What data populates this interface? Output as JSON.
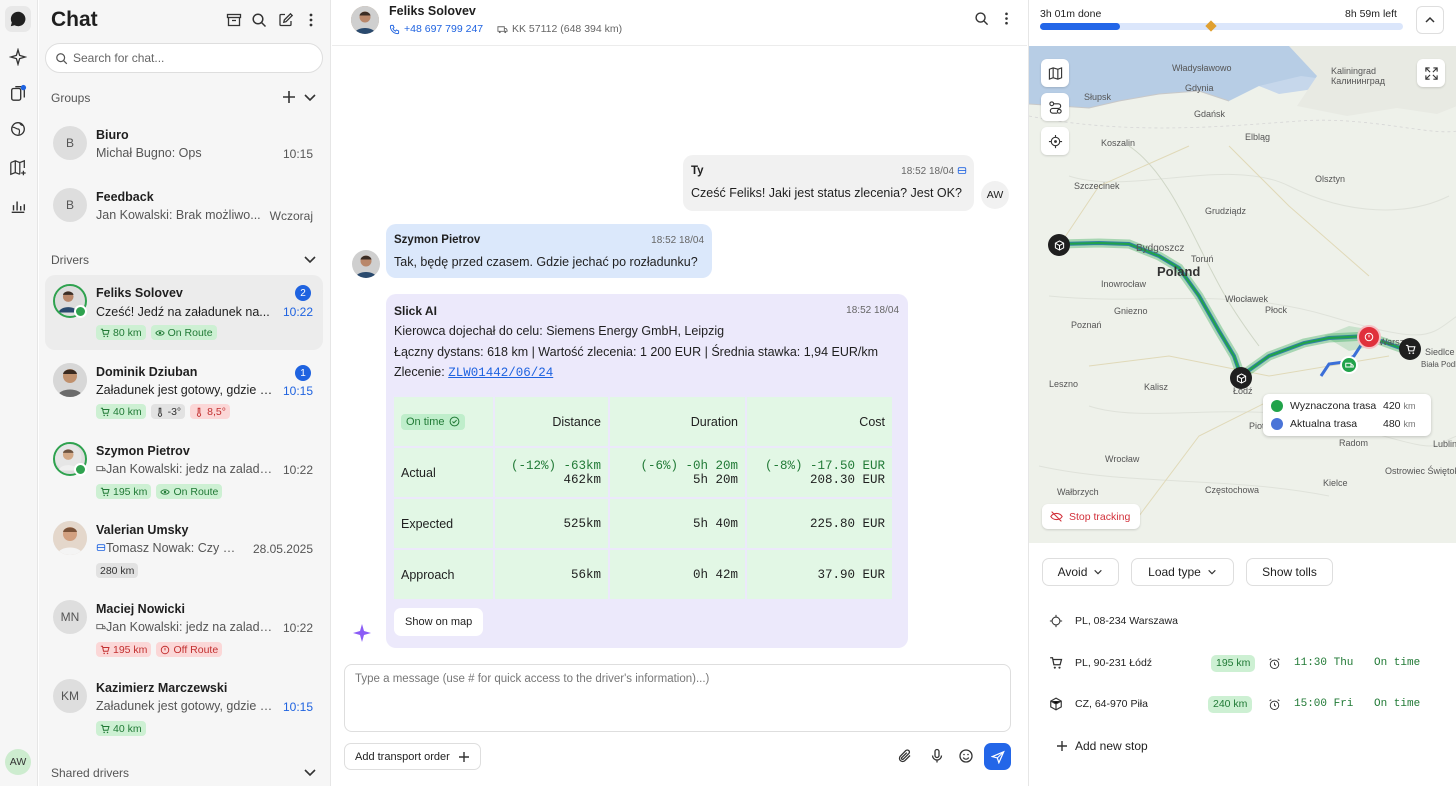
{
  "app": {
    "user_initials": "AW"
  },
  "sidebar": {
    "title": "Chat",
    "search_placeholder": "Search for chat...",
    "groups_label": "Groups",
    "drivers_label": "Drivers",
    "shared_label": "Shared drivers",
    "groups": [
      {
        "initial": "B",
        "name": "Biuro",
        "preview": "Michał Bugno: Ops",
        "time": "10:15"
      },
      {
        "initial": "B",
        "name": "Feedback",
        "preview": "Jan Kowalski: Brak możliwo...",
        "time": "Wczoraj"
      }
    ],
    "drivers": [
      {
        "name": "Feliks Solovev",
        "preview": "Cześć! Jedź na załadunek na...",
        "time": "10:22",
        "unread": "2",
        "chips": [
          "80 km",
          "On Route"
        ]
      },
      {
        "name": "Dominik Dziuban",
        "preview": "Załadunek jest gotowy, gdzie d...",
        "time": "10:15",
        "unread": "1",
        "chips": [
          "40 km",
          "-3°",
          "8,5°"
        ]
      },
      {
        "name": "Szymon Pietrov",
        "preview": "Jan Kowalski: jedz na zaladu...",
        "time": "10:22",
        "chips": [
          "195 km",
          "On Route"
        ]
      },
      {
        "name": "Valerian Umsky",
        "preview": "Tomasz Nowak: Czy m...",
        "time": "28.05.2025",
        "chips": [
          "280 km"
        ]
      },
      {
        "initials": "MN",
        "name": "Maciej Nowicki",
        "preview": "Jan Kowalski: jedz na zaladu...",
        "time": "10:22",
        "chips": [
          "195 km",
          "Off Route"
        ]
      },
      {
        "initials": "KM",
        "name": "Kazimierz Marczewski",
        "preview": "Załadunek jest gotowy, gdzie d...",
        "time": "10:15",
        "chips": [
          "40 km"
        ]
      }
    ]
  },
  "chat": {
    "contact_name": "Feliks Solovev",
    "phone": "+48 697 799 247",
    "truck": "KK 57112 (648 394 km)",
    "messages": [
      {
        "author": "Ty",
        "time": "18:52 18/04",
        "text": "Cześć Feliks! Jaki jest status zlecenia? Jest OK?",
        "avatar": "AW"
      },
      {
        "author": "Szymon Pietrov",
        "time": "18:52 18/04",
        "text": "Tak, będę przed czasem. Gdzie jechać po rozładunku?"
      }
    ],
    "ai": {
      "author": "Slick AI",
      "time": "18:52 18/04",
      "line1_prefix": "Kierowca dojechał do celu: ",
      "line1_value": "Siemens Energy GmbH, Leipzig",
      "dist_label": "Łączny dystans: ",
      "dist_value": "618 km",
      "value_label": " | Wartość zlecenia: ",
      "value_value": "1 200 EUR",
      "rate_label": " | Średnia stawka: ",
      "rate_value": "1,94 EUR/km",
      "order_label": "Zlecenie: ",
      "order_link": "ZLW01442/06/24",
      "status_badge": "On time",
      "columns": [
        "Distance",
        "Duration",
        "Cost"
      ],
      "rows": [
        {
          "label": "Actual",
          "delta": [
            "(-12%) -63km",
            "(-6%) -0h 20m",
            "(-8%) -17.50 EUR"
          ],
          "values": [
            "462km",
            "5h 20m",
            "208.30 EUR"
          ]
        },
        {
          "label": "Expected",
          "values": [
            "525km",
            "5h 40m",
            "225.80 EUR"
          ]
        },
        {
          "label": "Approach",
          "values": [
            "56km",
            "0h 42m",
            "37.90 EUR"
          ]
        }
      ],
      "show_on_map": "Show on map"
    },
    "composer_placeholder": "Type a message (use # for quick access to the driver's information)...)",
    "add_order_label": "Add transport order"
  },
  "trip": {
    "done_label": "3h 01m done",
    "left_label": "8h 59m left",
    "progress": 0.22,
    "marker": 0.47
  },
  "map": {
    "country_label": "Poland",
    "legend": [
      {
        "label": "Wyznaczona trasa",
        "value": "420",
        "unit": "km",
        "color": "#21a34a"
      },
      {
        "label": "Aktualna trasa",
        "value": "480",
        "unit": "km",
        "color": "#4a74d8"
      }
    ],
    "stop_tracking": "Stop tracking",
    "places": [
      "Kaliningrad",
      "Калининград",
      "Władysławowo",
      "Gdynia",
      "Gdańsk",
      "Elbląg",
      "Olsztyn",
      "Słupsk",
      "Szczecinek",
      "Grudziądz",
      "Bydgoszcz",
      "Toruń",
      "Inowrocław",
      "Gniezno",
      "Włocławek",
      "Płock",
      "Poznań",
      "Leszno",
      "Kalisz",
      "Łódź",
      "Warsz",
      "Wrocław",
      "Wałbrzych",
      "Częstochowa",
      "Kielce",
      "Radom",
      "Lublin",
      "Piotr",
      "Ostrowiec Świętokrzyski",
      "Biała Podlaska",
      "Siedlce",
      "Koszalin"
    ]
  },
  "controls": {
    "avoid": "Avoid",
    "load_type": "Load type",
    "show_tolls": "Show tolls"
  },
  "stops": [
    {
      "address": "PL, 08-234 Warszawa"
    },
    {
      "address": "PL, 90-231 Łódź",
      "distance": "195 km",
      "time": "11:30 Thu",
      "status": "On time"
    },
    {
      "address": "CZ, 64-970 Piła",
      "distance": "240 km",
      "time": "15:00 Fri",
      "status": "On time"
    }
  ],
  "add_stop": "Add new stop"
}
